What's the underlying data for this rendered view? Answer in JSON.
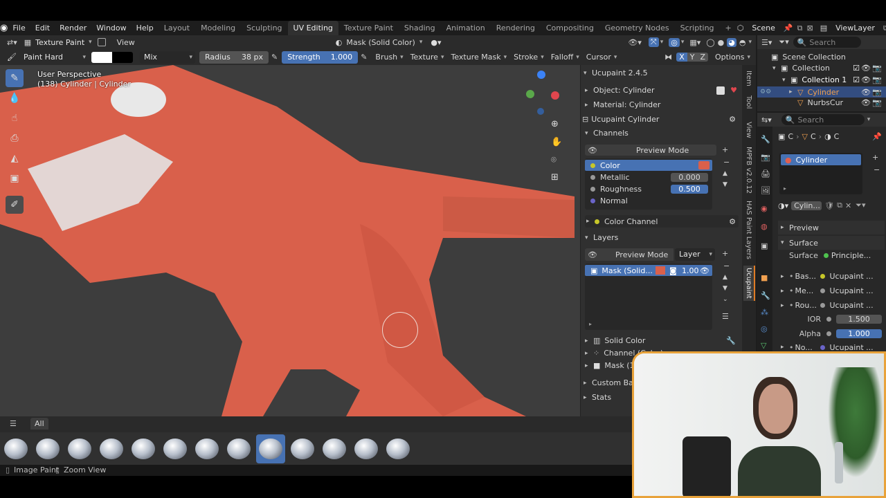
{
  "menubar": {
    "items": [
      "File",
      "Edit",
      "Render",
      "Window",
      "Help"
    ],
    "workspaces": [
      "Layout",
      "Modeling",
      "Sculpting",
      "UV Editing",
      "Texture Paint",
      "Shading",
      "Animation",
      "Rendering",
      "Compositing",
      "Geometry Nodes",
      "Scripting"
    ],
    "active_workspace": "UV Editing",
    "scene": "Scene",
    "view_layer": "ViewLayer",
    "add": "+"
  },
  "viewport_header": {
    "mode": "Texture Paint",
    "view": "View",
    "mask": "Mask (Solid Color)"
  },
  "tool_header": {
    "brush_name": "Paint Hard",
    "blend": "Mix",
    "radius_label": "Radius",
    "radius_value": "38 px",
    "strength_label": "Strength",
    "strength_value": "1.000",
    "brush": "Brush",
    "texture": "Texture",
    "texture_mask": "Texture Mask",
    "stroke": "Stroke",
    "falloff": "Falloff",
    "cursor": "Cursor",
    "options": "Options",
    "x": "X",
    "y": "Y",
    "z": "Z"
  },
  "viewport": {
    "perspective": "User Perspective",
    "object_info": "(138) Cylinder | Cylinder"
  },
  "ucupaint": {
    "title": "Ucupaint 2.4.5",
    "object": "Object: Cylinder",
    "material": "Material: Cylinder",
    "node": "Ucupaint Cylinder",
    "channels": "Channels",
    "preview_mode": "Preview Mode",
    "channel_list": [
      {
        "name": "Color",
        "value": ""
      },
      {
        "name": "Metallic",
        "value": "0.000"
      },
      {
        "name": "Roughness",
        "value": "0.500"
      },
      {
        "name": "Normal",
        "value": ""
      }
    ],
    "color_channel": "Color Channel",
    "layers": "Layers",
    "layer_preview": "Preview Mode",
    "layer_dropdown": "Layer",
    "layer_item": {
      "name": "Mask (Solid...",
      "value": "1.00"
    },
    "solid_color": "Solid Color",
    "channel_color": "Channel (Color)",
    "mask": "Mask (1)",
    "custom_bake": "Custom Bake",
    "stats": "Stats"
  },
  "side_tabs": [
    "Item",
    "Tool",
    "View",
    "MPFB v2.0.12",
    "HAS Paint Layers",
    "Ucupaint"
  ],
  "outliner": {
    "search": "Search",
    "scene_collection": "Scene Collection",
    "collection": "Collection",
    "collection1": "Collection 1",
    "cylinder": "Cylinder",
    "nurbs": "NurbsCur"
  },
  "properties": {
    "search": "Search",
    "crumbs": [
      "C",
      "C",
      "C"
    ],
    "material_slot": "Cylinder",
    "material_name": "Cylin...",
    "preview": "Preview",
    "surface": "Surface",
    "surface_label": "Surface",
    "surface_value": "Principle...",
    "inputs": [
      {
        "name": "Bas...",
        "value": "Ucupaint ..."
      },
      {
        "name": "Me...",
        "value": "Ucupaint ..."
      },
      {
        "name": "Rou...",
        "value": "Ucupaint ..."
      }
    ],
    "ior_label": "IOR",
    "ior_value": "1.500",
    "alpha_label": "Alpha",
    "alpha_value": "1.000",
    "normal_label": "No...",
    "normal_value": "Ucupaint ..."
  },
  "asset_shelf": {
    "tab": "All",
    "brush_count": 13,
    "active_index": 8
  },
  "statusbar": {
    "left": "Image Paint",
    "mid": "Zoom View"
  },
  "colors": {
    "accent": "#4772b3",
    "webcam_border": "#e8a23a",
    "paint": "#e0604a"
  }
}
